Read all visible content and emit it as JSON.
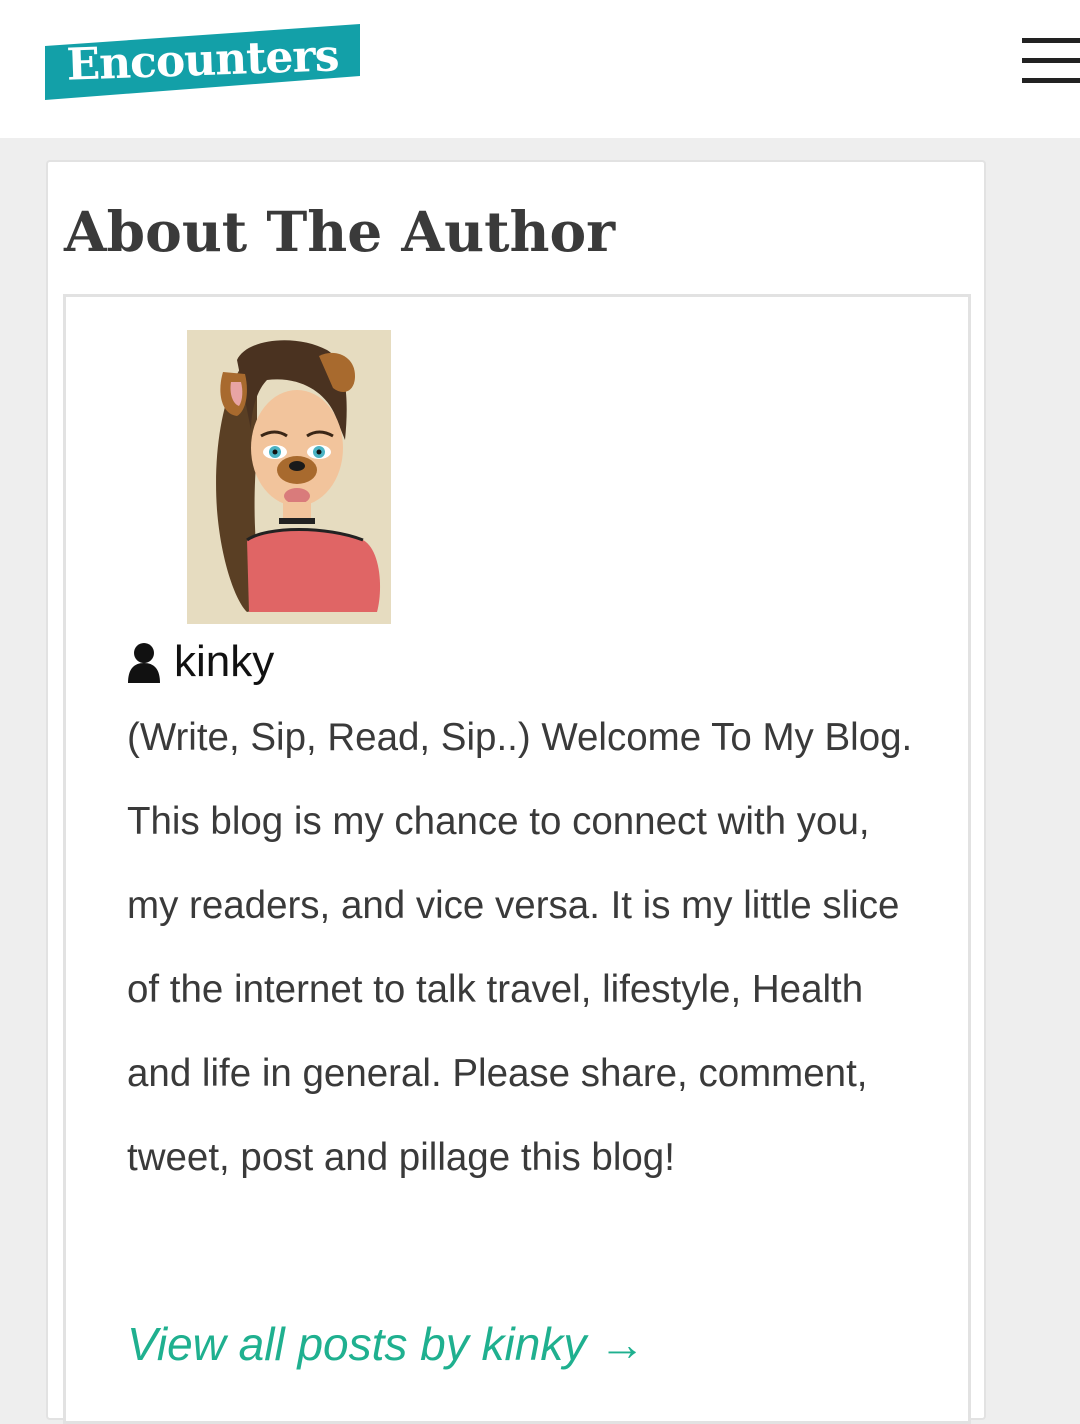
{
  "header": {
    "logo_text": "Encounters",
    "brand_color": "#13a0a8",
    "menu_icon": "hamburger-menu-icon"
  },
  "section": {
    "title": "About The Author"
  },
  "author": {
    "avatar_icon": "author-avatar-drawing",
    "user_icon": "user-icon",
    "name": "kinky",
    "bio": "(Write, Sip, Read, Sip..) Welcome To My Blog. This blog is my chance to connect with you, my readers, and vice versa. It is my little slice of the internet to talk travel, lifestyle, Health and life in general. Please share, comment, tweet, post and pillage this blog!",
    "link_text": "View all posts by kinky →",
    "link_color": "#1fb08f"
  }
}
